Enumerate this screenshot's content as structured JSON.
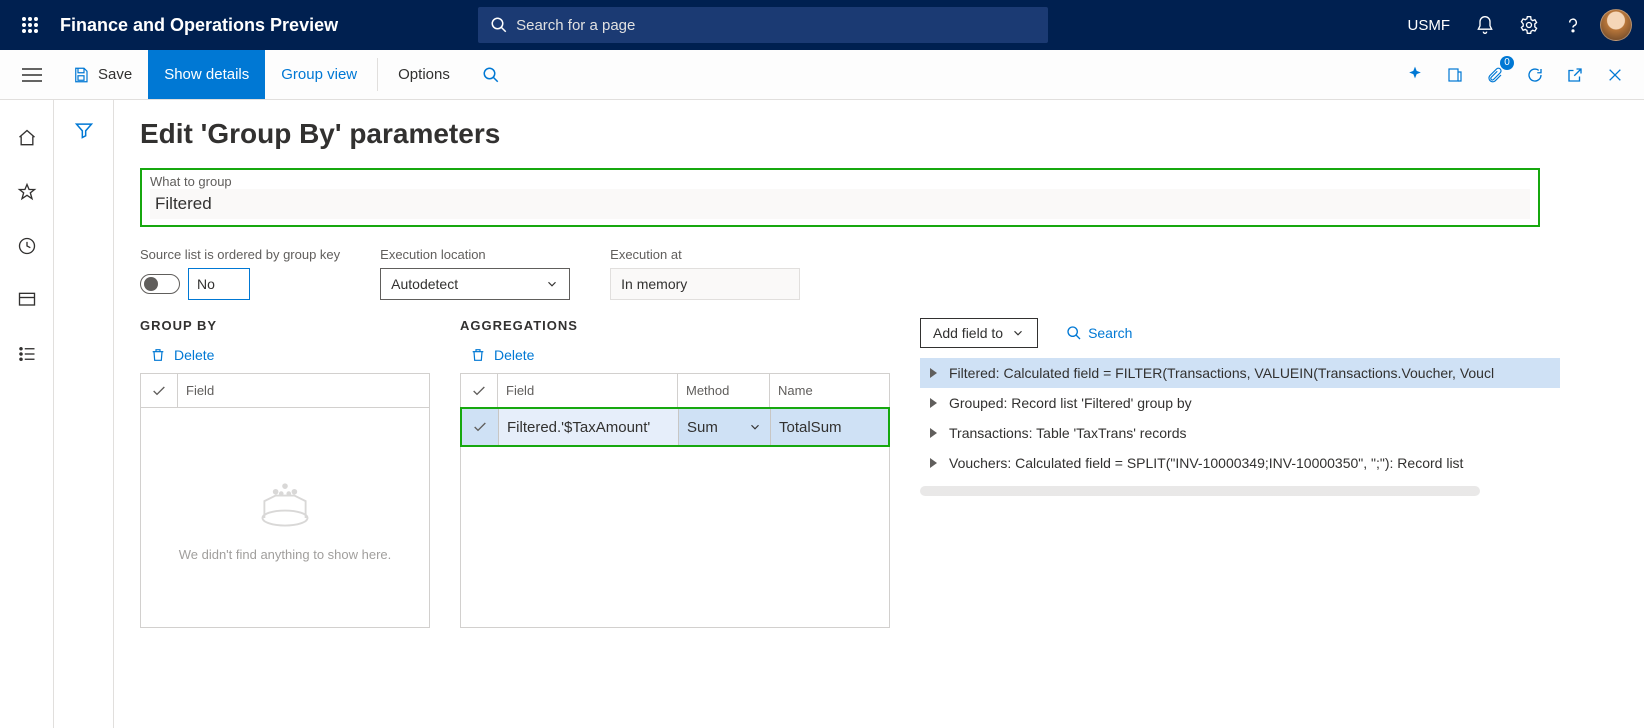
{
  "topbar": {
    "app_title": "Finance and Operations Preview",
    "search_placeholder": "Search for a page",
    "entity": "USMF"
  },
  "actionbar": {
    "save": "Save",
    "show_details": "Show details",
    "group_view": "Group view",
    "options": "Options",
    "attach_badge": "0"
  },
  "page": {
    "title": "Edit 'Group By' parameters",
    "what_to_group_label": "What to group",
    "what_to_group_value": "Filtered",
    "source_ordered_label": "Source list is ordered by group key",
    "source_ordered_value": "No",
    "execution_location_label": "Execution location",
    "execution_location_value": "Autodetect",
    "execution_at_label": "Execution at",
    "execution_at_value": "In memory"
  },
  "groupby": {
    "section": "GROUP BY",
    "delete": "Delete",
    "col_field": "Field",
    "empty_msg": "We didn't find anything to show here."
  },
  "agg": {
    "section": "AGGREGATIONS",
    "delete": "Delete",
    "col_field": "Field",
    "col_method": "Method",
    "col_name": "Name",
    "row": {
      "field": "Filtered.'$TaxAmount'",
      "method": "Sum",
      "name": "TotalSum"
    }
  },
  "rightpane": {
    "add_field": "Add field to",
    "search": "Search",
    "items": [
      "Filtered: Calculated field = FILTER(Transactions, VALUEIN(Transactions.Voucher, Voucl",
      "Grouped: Record list 'Filtered' group by",
      "Transactions: Table 'TaxTrans' records",
      "Vouchers: Calculated field = SPLIT(\"INV-10000349;INV-10000350\", \";\"): Record list"
    ]
  }
}
